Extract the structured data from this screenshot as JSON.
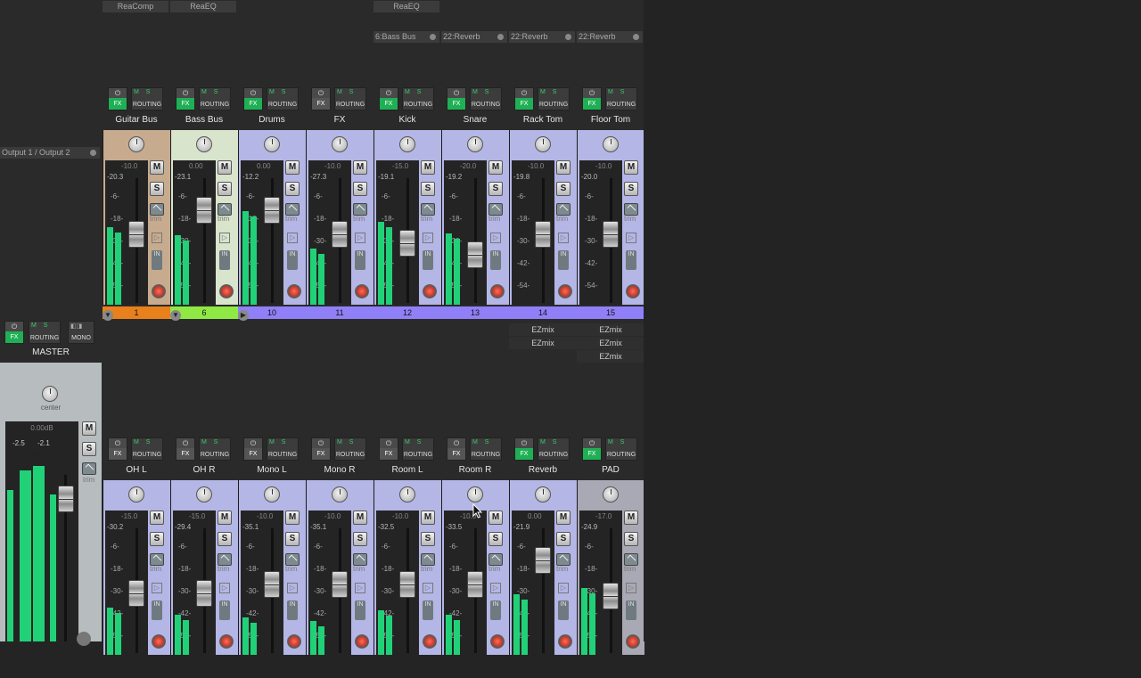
{
  "fx_row": {
    "guitar_bus": "ReaComp",
    "bass_bus": "ReaEQ",
    "kick": "ReaEQ"
  },
  "sends": [
    {
      "label": "6:Bass Bus"
    },
    {
      "label": "22:Reverb"
    },
    {
      "label": "22:Reverb"
    },
    {
      "label": "22:Reverb"
    }
  ],
  "master": {
    "output": "Output 1 / Output 2",
    "name": "MASTER",
    "pan": "center",
    "vol": "0.00dB",
    "peak_l": "-2.5",
    "peak_r": "-2.1",
    "routing": "ROUTING",
    "mono": "MONO",
    "fx": "FX",
    "m": "M",
    "s": "S",
    "trim": "trim",
    "scale": [
      "-0-",
      "6",
      "12",
      "18",
      "24",
      "30",
      "36",
      "42",
      "48",
      "54"
    ],
    "meter_l": 0.8,
    "meter_r": 0.82
  },
  "common": {
    "fx": "FX",
    "routing": "ROUTING",
    "m": "M",
    "s": "S",
    "trim": "trim",
    "in": "IN",
    "ms": "M S",
    "play": "▷"
  },
  "top_strips": [
    {
      "name": "Guitar Bus",
      "vol": "-10.0",
      "peak": "-20.3",
      "num": "1",
      "color": "#c7ab8e",
      "numcolor": "#e8801c",
      "fx_on": true,
      "meter": 0.58,
      "fader": 0.55
    },
    {
      "name": "Bass Bus",
      "vol": "0.00",
      "peak": "-23.1",
      "num": "6",
      "color": "#d8e4cc",
      "numcolor": "#8fe844",
      "fx_on": true,
      "meter": 0.52,
      "fader": 0.76
    },
    {
      "name": "Drums",
      "vol": "0.00",
      "peak": "-12.2",
      "num": "10",
      "color": "#b4b6e6",
      "numcolor": "#8f80f8",
      "fx_on": true,
      "meter": 0.7,
      "fader": 0.76
    },
    {
      "name": "FX",
      "vol": "-10.0",
      "peak": "-27.3",
      "num": "11",
      "color": "#b4b6e6",
      "numcolor": "#8f80f8",
      "fx_on": false,
      "meter": 0.42,
      "fader": 0.55
    },
    {
      "name": "Kick",
      "vol": "-15.0",
      "peak": "-19.1",
      "num": "12",
      "color": "#b4b6e6",
      "numcolor": "#8f80f8",
      "fx_on": true,
      "meter": 0.62,
      "fader": 0.48
    },
    {
      "name": "Snare",
      "vol": "-20.0",
      "peak": "-19.2",
      "num": "13",
      "color": "#b4b6e6",
      "numcolor": "#8f80f8",
      "fx_on": true,
      "meter": 0.53,
      "fader": 0.38
    },
    {
      "name": "Rack Tom",
      "vol": "-10.0",
      "peak": "-19.8",
      "num": "14",
      "color": "#b4b6e6",
      "numcolor": "#8f80f8",
      "fx_on": true,
      "meter": 0.0,
      "fader": 0.55
    },
    {
      "name": "Floor Tom",
      "vol": "-10.0",
      "peak": "-20.0",
      "num": "15",
      "color": "#b4b6e6",
      "numcolor": "#8f80f8",
      "fx_on": true,
      "meter": 0.0,
      "fader": 0.55
    }
  ],
  "ezmix": {
    "rack_tom": [
      "EZmix",
      "EZmix"
    ],
    "floor_tom": [
      "EZmix",
      "EZmix",
      "EZmix"
    ]
  },
  "bottom_strips": [
    {
      "name": "OH L",
      "vol": "-15.0",
      "peak": "-30.2",
      "color": "#b4b6e6",
      "fx_on": false,
      "meter": 0.35,
      "fader": 0.48
    },
    {
      "name": "OH R",
      "vol": "-15.0",
      "peak": "-29.4",
      "color": "#b4b6e6",
      "fx_on": false,
      "meter": 0.3,
      "fader": 0.48
    },
    {
      "name": "Mono L",
      "vol": "-10.0",
      "peak": "-35.1",
      "color": "#b4b6e6",
      "fx_on": false,
      "meter": 0.28,
      "fader": 0.55
    },
    {
      "name": "Mono R",
      "vol": "-10.0",
      "peak": "-35.1",
      "color": "#b4b6e6",
      "fx_on": false,
      "meter": 0.25,
      "fader": 0.55
    },
    {
      "name": "Room L",
      "vol": "-10.0",
      "peak": "-32.5",
      "color": "#b4b6e6",
      "fx_on": false,
      "meter": 0.33,
      "fader": 0.55
    },
    {
      "name": "Room R",
      "vol": "-10.0",
      "peak": "-33.5",
      "color": "#b4b6e6",
      "fx_on": false,
      "meter": 0.3,
      "fader": 0.55
    },
    {
      "name": "Reverb",
      "vol": "0.00",
      "peak": "-21.9",
      "color": "#b4b6e6",
      "fx_on": true,
      "meter": 0.45,
      "fader": 0.76
    },
    {
      "name": "PAD",
      "vol": "-17.0",
      "peak": "-24.9",
      "color": "#a9a9b5",
      "fx_on": true,
      "meter": 0.5,
      "fader": 0.45
    }
  ],
  "scale": [
    "-6-",
    "-18-",
    "-30-",
    "-42-",
    "-54-"
  ]
}
